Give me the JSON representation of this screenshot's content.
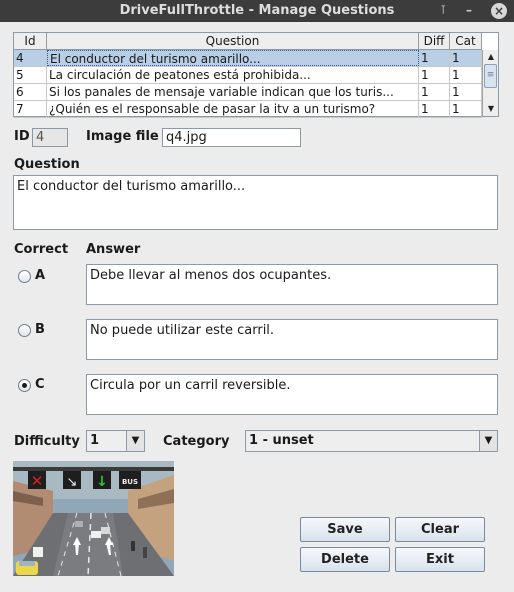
{
  "window": {
    "title": "DriveFullThrottle - Manage Questions",
    "pin_icon": "pin-icon",
    "minimize_icon": "minimize-icon",
    "close_icon": "close-icon"
  },
  "table": {
    "columns": [
      "Id",
      "Question",
      "Diff",
      "Cat"
    ],
    "rows": [
      {
        "id": "4",
        "question": "El conductor del turismo amarillo...",
        "diff": "1",
        "cat": "1"
      },
      {
        "id": "5",
        "question": "La circulación de peatones está prohibida...",
        "diff": "1",
        "cat": "1"
      },
      {
        "id": "6",
        "question": "Si los panales de mensaje variable indican que los turis...",
        "diff": "1",
        "cat": "1"
      },
      {
        "id": "7",
        "question": "¿Quién es el responsable de pasar la itv a un turismo?",
        "diff": "1",
        "cat": "1"
      }
    ],
    "selected_index": 0
  },
  "form": {
    "id_label": "ID",
    "id_value": "4",
    "image_label": "Image file",
    "image_value": "q4.jpg",
    "question_label": "Question",
    "question_value": "El conductor del turismo amarillo...",
    "correct_label": "Correct",
    "answer_label": "Answer",
    "answers": [
      {
        "letter": "A",
        "text": "Debe llevar al menos dos ocupantes.",
        "selected": false
      },
      {
        "letter": "B",
        "text": "No puede utilizar este carril.",
        "selected": false
      },
      {
        "letter": "C",
        "text": "Circula por un carril reversible.",
        "selected": true
      }
    ],
    "difficulty_label": "Difficulty",
    "difficulty_value": "1",
    "category_label": "Category",
    "category_value": "1 - unset"
  },
  "buttons": {
    "save": "Save",
    "clear": "Clear",
    "delete": "Delete",
    "exit": "Exit"
  },
  "image_preview": {
    "sign_labels": [
      "BUS"
    ]
  },
  "colors": {
    "titlebar": "#3c3c3c",
    "selection": "#b8cfe5",
    "sign_red": "#d42020",
    "sign_green": "#2fc42f"
  }
}
